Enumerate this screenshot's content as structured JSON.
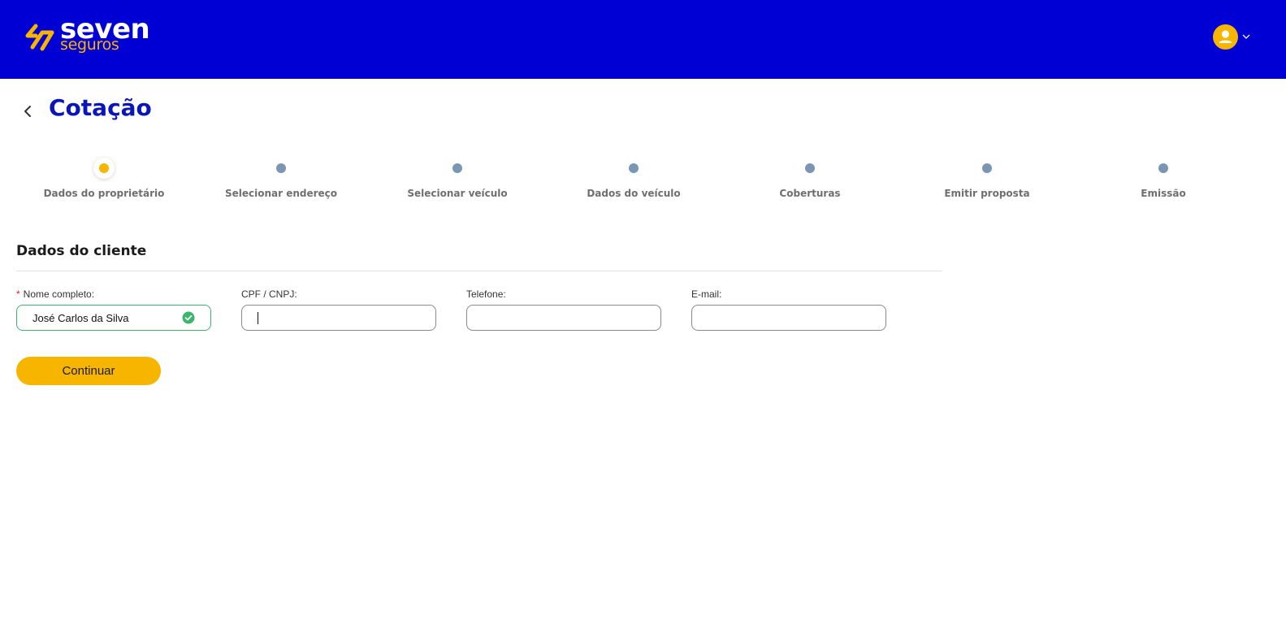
{
  "header": {
    "brand_primary": "seven",
    "brand_secondary": "seguros",
    "logo_icon": "seven-logo-mark",
    "user_icon": "user-icon",
    "menu_icon": "chevron-down-icon",
    "colors": {
      "bar": "#0000d4",
      "accent": "#f7b500"
    }
  },
  "page": {
    "title": "Cotação",
    "back_icon": "chevron-left-icon"
  },
  "stepper": {
    "active_index": 0,
    "steps": [
      {
        "label": "Dados do proprietário"
      },
      {
        "label": "Selecionar endereço"
      },
      {
        "label": "Selecionar veículo"
      },
      {
        "label": "Dados do veículo"
      },
      {
        "label": "Coberturas"
      },
      {
        "label": "Emitir proposta"
      },
      {
        "label": "Emissão"
      }
    ]
  },
  "form": {
    "section_title": "Dados do cliente",
    "fields": [
      {
        "required_mark": "*",
        "label": "Nome completo:",
        "value": "José Carlos da Silva",
        "status": "valid"
      },
      {
        "label": "CPF / CNPJ:",
        "value": "",
        "focused": true
      },
      {
        "label": "Telefone:",
        "value": ""
      },
      {
        "label": "E-mail:",
        "value": ""
      }
    ],
    "submit_label": "Continuar"
  }
}
